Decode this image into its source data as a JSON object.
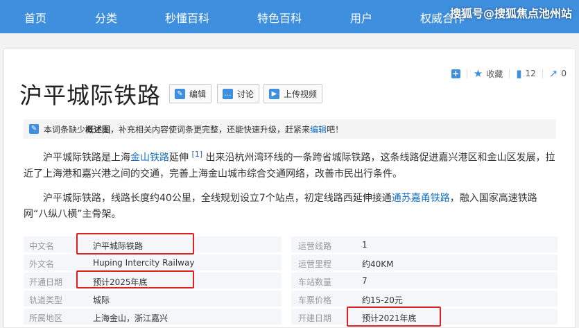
{
  "nav": {
    "items": [
      "首页",
      "分类",
      "秒懂百科",
      "特色百科",
      "用户",
      "权威合作"
    ],
    "watermark": "搜狐号@搜狐焦点池州站"
  },
  "title": "沪平城际铁路",
  "buttons": {
    "edit": "编辑",
    "discuss": "讨论",
    "upload": "上传视频"
  },
  "tools": {
    "collect": "收藏",
    "like_count": "12",
    "share_count": "0"
  },
  "notice": {
    "pre": "本词条缺少",
    "bold": "概述图",
    "mid": "，补充相关内容使词条更完整，还能快速升级，赶紧来",
    "link": "编辑",
    "post": "吧！"
  },
  "paragraph1": {
    "a": "沪平城际铁路是上海",
    "link1": "金山铁路",
    "b": "延伸",
    "ref": "[1]",
    "c": "出来沿杭州湾环线的一条跨省城际铁路，这条线路促进嘉兴港区和金山区发展，拉近了上海港和嘉兴港之间的交通，完善上海金山城市综合交通网络，改善市民出行条件。"
  },
  "paragraph2": {
    "a": "沪平城际铁路，线路长度约40公里，全线规划设立7个站点，初定线路西延伸接通",
    "link1": "通苏嘉甬铁路",
    "b": "，融入国家高速铁路网“八纵八横”主骨架。"
  },
  "infobox": [
    {
      "k1": "中文名",
      "v1": "沪平城际铁路",
      "k2": "运营线路",
      "v2": "1"
    },
    {
      "k1": "外文名",
      "v1": "Huping Intercity Railway",
      "k2": "运营里程",
      "v2": "约40KM"
    },
    {
      "k1": "开通日期",
      "v1": "预计2025年底",
      "k2": "车站数量",
      "v2": "7"
    },
    {
      "k1": "轨道类型",
      "v1": "城际",
      "k2": "车票价格",
      "v2": "约15-20元"
    },
    {
      "k1": "所属地区",
      "v1": "上海金山，浙江嘉兴",
      "k2": "开建日期",
      "v2": "预计2021年底"
    }
  ]
}
